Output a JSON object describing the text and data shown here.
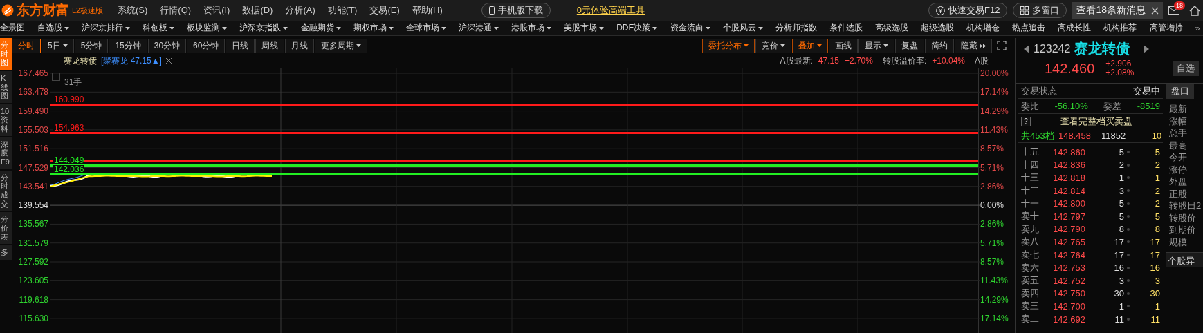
{
  "app": {
    "logo": "东方财富",
    "edition": "L2极速版"
  },
  "menu": [
    "系统(S)",
    "行情(Q)",
    "资讯(I)",
    "数据(D)",
    "分析(A)",
    "功能(T)",
    "交易(E)",
    "帮助(H)"
  ],
  "mobile_download": "手机版下载",
  "promo_link": "0元体验高端工具",
  "quick_trade": "快速交易F12",
  "multi_window": "多窗口",
  "news_notice": "查看18条新消息",
  "mail_badge": "18",
  "nav": [
    {
      "label": "全景图",
      "dropdown": false
    },
    {
      "label": "自选股",
      "dropdown": true
    },
    {
      "label": "沪深京排行",
      "dropdown": true
    },
    {
      "label": "科创板",
      "dropdown": true
    },
    {
      "label": "板块监测",
      "dropdown": true
    },
    {
      "label": "沪深京指数",
      "dropdown": true
    },
    {
      "label": "金融期货",
      "dropdown": true
    },
    {
      "label": "期权市场",
      "dropdown": true
    },
    {
      "label": "全球市场",
      "dropdown": true
    },
    {
      "label": "沪深港通",
      "dropdown": true
    },
    {
      "label": "港股市场",
      "dropdown": true
    },
    {
      "label": "美股市场",
      "dropdown": true
    },
    {
      "label": "DDE决策",
      "dropdown": true
    },
    {
      "label": "资金流向",
      "dropdown": true
    },
    {
      "label": "个股风云",
      "dropdown": true
    },
    {
      "label": "分析师指数",
      "dropdown": false
    },
    {
      "label": "条件选股",
      "dropdown": false
    },
    {
      "label": "高级选股",
      "dropdown": false
    },
    {
      "label": "超级选股",
      "dropdown": false
    },
    {
      "label": "机构增仓",
      "dropdown": false
    },
    {
      "label": "热点追击",
      "dropdown": false
    },
    {
      "label": "高成长性",
      "dropdown": false
    },
    {
      "label": "机构推荐",
      "dropdown": false
    },
    {
      "label": "高管增持",
      "dropdown": false
    }
  ],
  "nav_more": "»",
  "periods": [
    {
      "label": "分时",
      "selected": true,
      "dropdown": false
    },
    {
      "label": "5日",
      "selected": false,
      "dropdown": true
    },
    {
      "label": "5分钟",
      "selected": false,
      "dropdown": false
    },
    {
      "label": "15分钟",
      "selected": false,
      "dropdown": false
    },
    {
      "label": "30分钟",
      "selected": false,
      "dropdown": false
    },
    {
      "label": "60分钟",
      "selected": false,
      "dropdown": false
    },
    {
      "label": "日线",
      "selected": false,
      "dropdown": false
    },
    {
      "label": "周线",
      "selected": false,
      "dropdown": false
    },
    {
      "label": "月线",
      "selected": false,
      "dropdown": false
    },
    {
      "label": "更多周期",
      "selected": false,
      "dropdown": true
    }
  ],
  "tools": [
    {
      "kind": "button",
      "label": "委托分布",
      "dropdown": true,
      "active": true
    },
    {
      "kind": "button",
      "label": "竞价",
      "dropdown": true,
      "active": false
    },
    {
      "kind": "button",
      "label": "叠加",
      "dropdown": true,
      "active": true
    },
    {
      "kind": "button",
      "label": "画线",
      "dropdown": false,
      "active": false
    },
    {
      "kind": "button",
      "label": "显示",
      "dropdown": true,
      "active": false
    },
    {
      "kind": "button",
      "label": "复盘",
      "dropdown": false,
      "active": false
    },
    {
      "kind": "button",
      "label": "简约",
      "dropdown": false,
      "active": false
    },
    {
      "kind": "collapse",
      "label": "隐藏",
      "dropdown": false,
      "active": false
    }
  ],
  "side_tabs": [
    {
      "label": "分时图",
      "selected": true
    },
    {
      "label": "K线图",
      "selected": false
    },
    {
      "label": "10资料",
      "selected": false
    },
    {
      "label": "深度F9",
      "selected": false
    },
    {
      "label": "分时成交",
      "selected": false
    },
    {
      "label": "分价表",
      "selected": false
    },
    {
      "label": "多",
      "selected": false
    }
  ],
  "chart": {
    "title": "赛龙转债",
    "overlay": "[聚赛龙 47.15▲]",
    "volume_note": "31手",
    "stock_info": [
      {
        "kind": "label",
        "text": "A股最新:"
      },
      {
        "kind": "value",
        "text": "47.15"
      },
      {
        "kind": "value",
        "text": "+2.70%"
      },
      {
        "kind": "label",
        "text": "转股溢价率:"
      },
      {
        "kind": "value",
        "text": "+10.04%"
      },
      {
        "kind": "label",
        "text": "A股"
      }
    ],
    "price_axis": [
      {
        "text": "167.465",
        "kind": "up"
      },
      {
        "text": "163.478",
        "kind": "up"
      },
      {
        "text": "159.490",
        "kind": "up"
      },
      {
        "text": "155.503",
        "kind": "up"
      },
      {
        "text": "151.516",
        "kind": "up"
      },
      {
        "text": "147.529",
        "kind": "up"
      },
      {
        "text": "143.541",
        "kind": "up"
      },
      {
        "text": "139.554",
        "kind": "flat"
      },
      {
        "text": "135.567",
        "kind": "down"
      },
      {
        "text": "131.579",
        "kind": "down"
      },
      {
        "text": "127.592",
        "kind": "down"
      },
      {
        "text": "123.605",
        "kind": "down"
      },
      {
        "text": "119.618",
        "kind": "down"
      },
      {
        "text": "115.630",
        "kind": "down"
      }
    ],
    "percent_axis": [
      {
        "text": "20.00%",
        "kind": "up"
      },
      {
        "text": "17.14%",
        "kind": "up"
      },
      {
        "text": "14.29%",
        "kind": "up"
      },
      {
        "text": "11.43%",
        "kind": "up"
      },
      {
        "text": "8.57%",
        "kind": "up"
      },
      {
        "text": "5.71%",
        "kind": "up"
      },
      {
        "text": "2.86%",
        "kind": "up"
      },
      {
        "text": "0.00%",
        "kind": "flat"
      },
      {
        "text": "2.86%",
        "kind": "down"
      },
      {
        "text": "5.71%",
        "kind": "down"
      },
      {
        "text": "8.57%",
        "kind": "down"
      },
      {
        "text": "11.43%",
        "kind": "down"
      },
      {
        "text": "14.29%",
        "kind": "down"
      },
      {
        "text": "17.14%",
        "kind": "down"
      }
    ],
    "price_lines": [
      {
        "label": "160.990",
        "color": "#ff1a1a"
      },
      {
        "label": "154.963",
        "color": "#ff1a1a"
      },
      {
        "color": "#ff1a1a"
      },
      {
        "label": "144.049",
        "color": "#22ee22"
      },
      {
        "label": "142.036",
        "color": "#22ee22"
      }
    ]
  },
  "quote": {
    "code": "123242",
    "name": "赛龙转债",
    "price": "142.460",
    "change": "+2.906",
    "change_pct": "+2.08%",
    "watch_button": "自选"
  },
  "status": {
    "label": "交易状态",
    "value": "交易中"
  },
  "ratio": {
    "label": "委比",
    "value": "-56.10%",
    "diff_label": "委差",
    "diff_value": "-8519"
  },
  "full_book": {
    "help": "?",
    "label": "查看完整档买卖盘"
  },
  "summary": {
    "levels": "共453档",
    "price": "148.458",
    "volume": "11852",
    "count": "10"
  },
  "asks": [
    {
      "label": "十五",
      "price": "142.860",
      "volume": "5",
      "count": "5"
    },
    {
      "label": "十四",
      "price": "142.836",
      "volume": "2",
      "count": "2"
    },
    {
      "label": "十三",
      "price": "142.818",
      "volume": "1",
      "count": "1"
    },
    {
      "label": "十二",
      "price": "142.814",
      "volume": "3",
      "count": "2"
    },
    {
      "label": "十一",
      "price": "142.800",
      "volume": "5",
      "count": "2"
    },
    {
      "label": "卖十",
      "price": "142.797",
      "volume": "5",
      "count": "5"
    },
    {
      "label": "卖九",
      "price": "142.790",
      "volume": "8",
      "count": "8"
    },
    {
      "label": "卖八",
      "price": "142.765",
      "volume": "17",
      "count": "17"
    },
    {
      "label": "卖七",
      "price": "142.764",
      "volume": "17",
      "count": "17"
    },
    {
      "label": "卖六",
      "price": "142.753",
      "volume": "16",
      "count": "16"
    },
    {
      "label": "卖五",
      "price": "142.752",
      "volume": "3",
      "count": "3"
    },
    {
      "label": "卖四",
      "price": "142.750",
      "volume": "30",
      "count": "30"
    },
    {
      "label": "卖三",
      "price": "142.700",
      "volume": "1",
      "count": "1"
    },
    {
      "label": "卖二",
      "price": "142.692",
      "volume": "11",
      "count": "11"
    }
  ],
  "side_panel": {
    "tab": "盘口",
    "fields": [
      "最新",
      "涨幅",
      "总手",
      "最高",
      "今开",
      "涨停",
      "外盘",
      "正股",
      "转股日2",
      "转股价",
      "到期价",
      "规模"
    ],
    "section": "个股异"
  }
}
